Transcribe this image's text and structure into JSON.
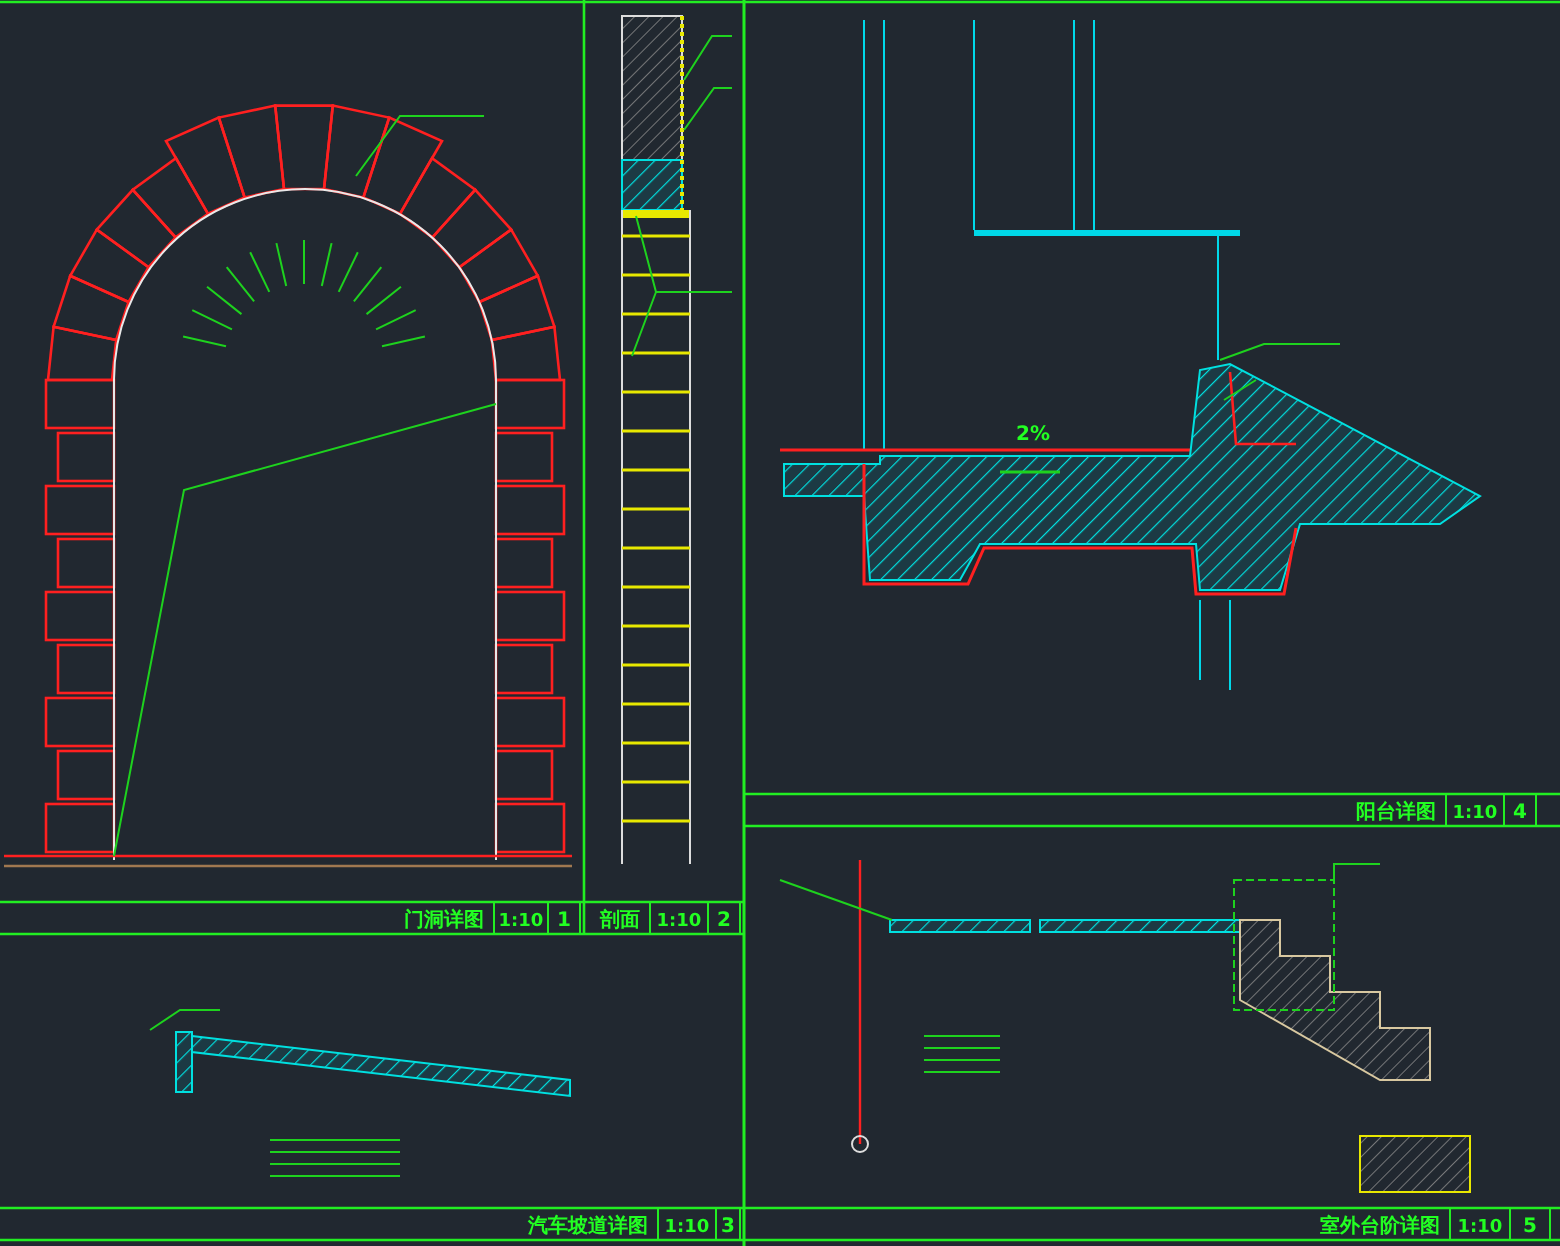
{
  "drawings": [
    {
      "title": "门洞详图",
      "scale": "1:10",
      "number": "1"
    },
    {
      "title": "剖面",
      "scale": "1:10",
      "number": "2"
    },
    {
      "title": "汽车坡道详图",
      "scale": "1:10",
      "number": "3"
    },
    {
      "title": "阳台详图",
      "scale": "1:10",
      "number": "4"
    },
    {
      "title": "室外台阶详图",
      "scale": "1:10",
      "number": "5"
    }
  ],
  "annotations": [
    {
      "text": "2%"
    }
  ]
}
